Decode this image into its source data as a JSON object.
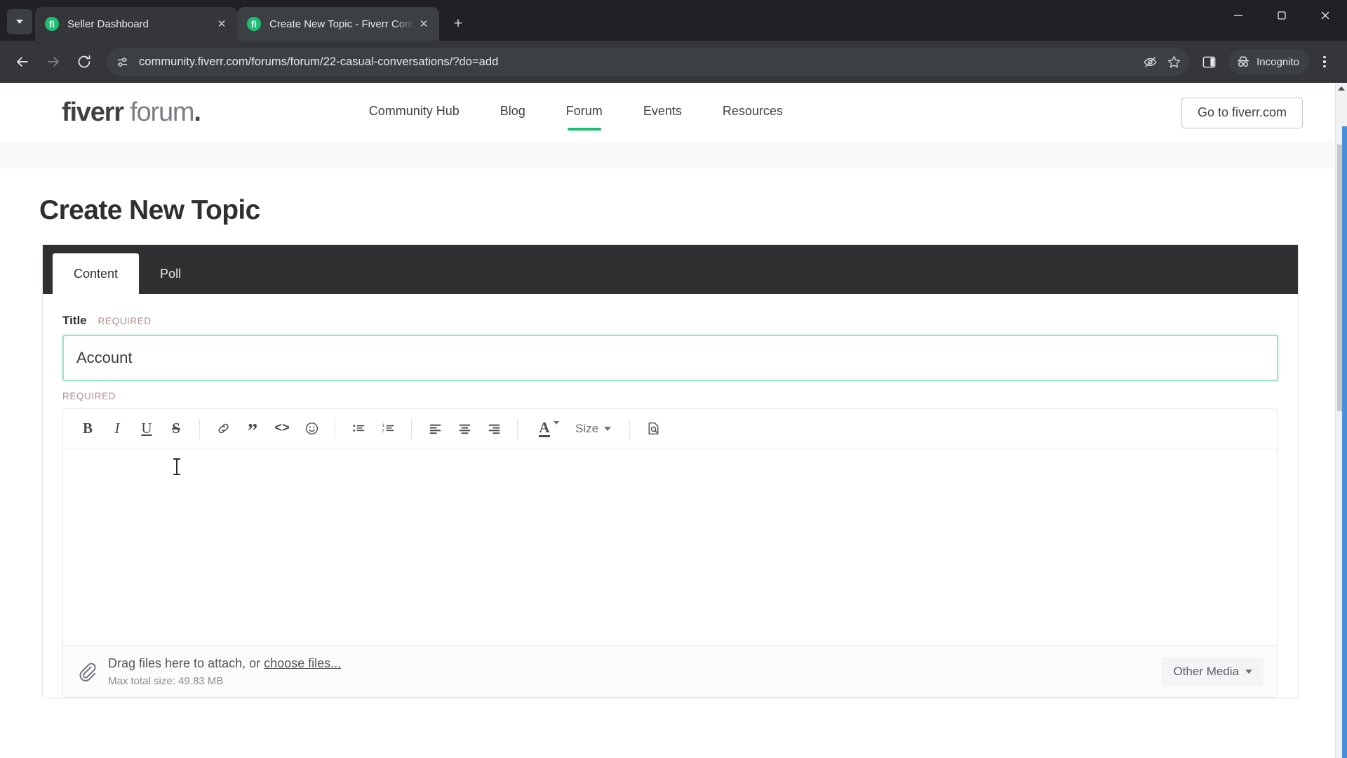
{
  "browser": {
    "tab_search_icon": "chevron-down-icon",
    "tabs": [
      {
        "title": "Seller Dashboard",
        "favicon": "fiverr-favicon",
        "active": false
      },
      {
        "title": "Create New Topic - Fiverr Comm",
        "favicon": "fiverr-favicon",
        "active": true
      }
    ],
    "new_tab_label": "+",
    "window_controls": {
      "minimize": "—",
      "maximize": "❐",
      "close": "✕"
    },
    "nav": {
      "back": "back-icon",
      "forward": "forward-icon",
      "reload": "reload-icon"
    },
    "omnibox": {
      "url": "community.fiverr.com/forums/forum/22-casual-conversations/?do=add",
      "site_info_icon": "site-settings-icon",
      "tracking_icon": "eye-off-icon",
      "bookmark_icon": "star-icon"
    },
    "side_panel_icon": "side-panel-icon",
    "incognito_label": "Incognito",
    "menu_icon": "kebab-menu-icon"
  },
  "site": {
    "logo": {
      "bold": "fiverr",
      "light": " forum",
      "dot": "."
    },
    "nav_items": [
      {
        "label": "Community Hub",
        "active": false
      },
      {
        "label": "Blog",
        "active": false
      },
      {
        "label": "Forum",
        "active": true
      },
      {
        "label": "Events",
        "active": false
      },
      {
        "label": "Resources",
        "active": false
      }
    ],
    "cta_label": "Go to fiverr.com",
    "accent_color": "#1dbf73"
  },
  "page": {
    "title": "Create New Topic",
    "tabs": [
      {
        "label": "Content",
        "active": true
      },
      {
        "label": "Poll",
        "active": false
      }
    ],
    "title_field": {
      "label": "Title",
      "required_label": "REQUIRED",
      "value": "Account",
      "placeholder": ""
    },
    "body_field": {
      "required_label": "REQUIRED",
      "content": ""
    },
    "editor_toolbar": {
      "bold": "B",
      "italic": "I",
      "underline": "U",
      "strike": "S",
      "link": "link-icon",
      "quote": "”",
      "code": "<>",
      "emoji": "emoji-icon",
      "bullet_list": "bullet-list-icon",
      "numbered_list": "numbered-list-icon",
      "align_left": "align-left-icon",
      "align_center": "align-center-icon",
      "align_right": "align-right-icon",
      "text_color": "A",
      "size_label": "Size",
      "preview": "preview-icon"
    },
    "attachments": {
      "icon": "paperclip-icon",
      "prompt_prefix": "Drag files here to attach, or ",
      "prompt_link": "choose files...",
      "max_size": "Max total size: 49.83 MB",
      "other_media_label": "Other Media"
    }
  }
}
